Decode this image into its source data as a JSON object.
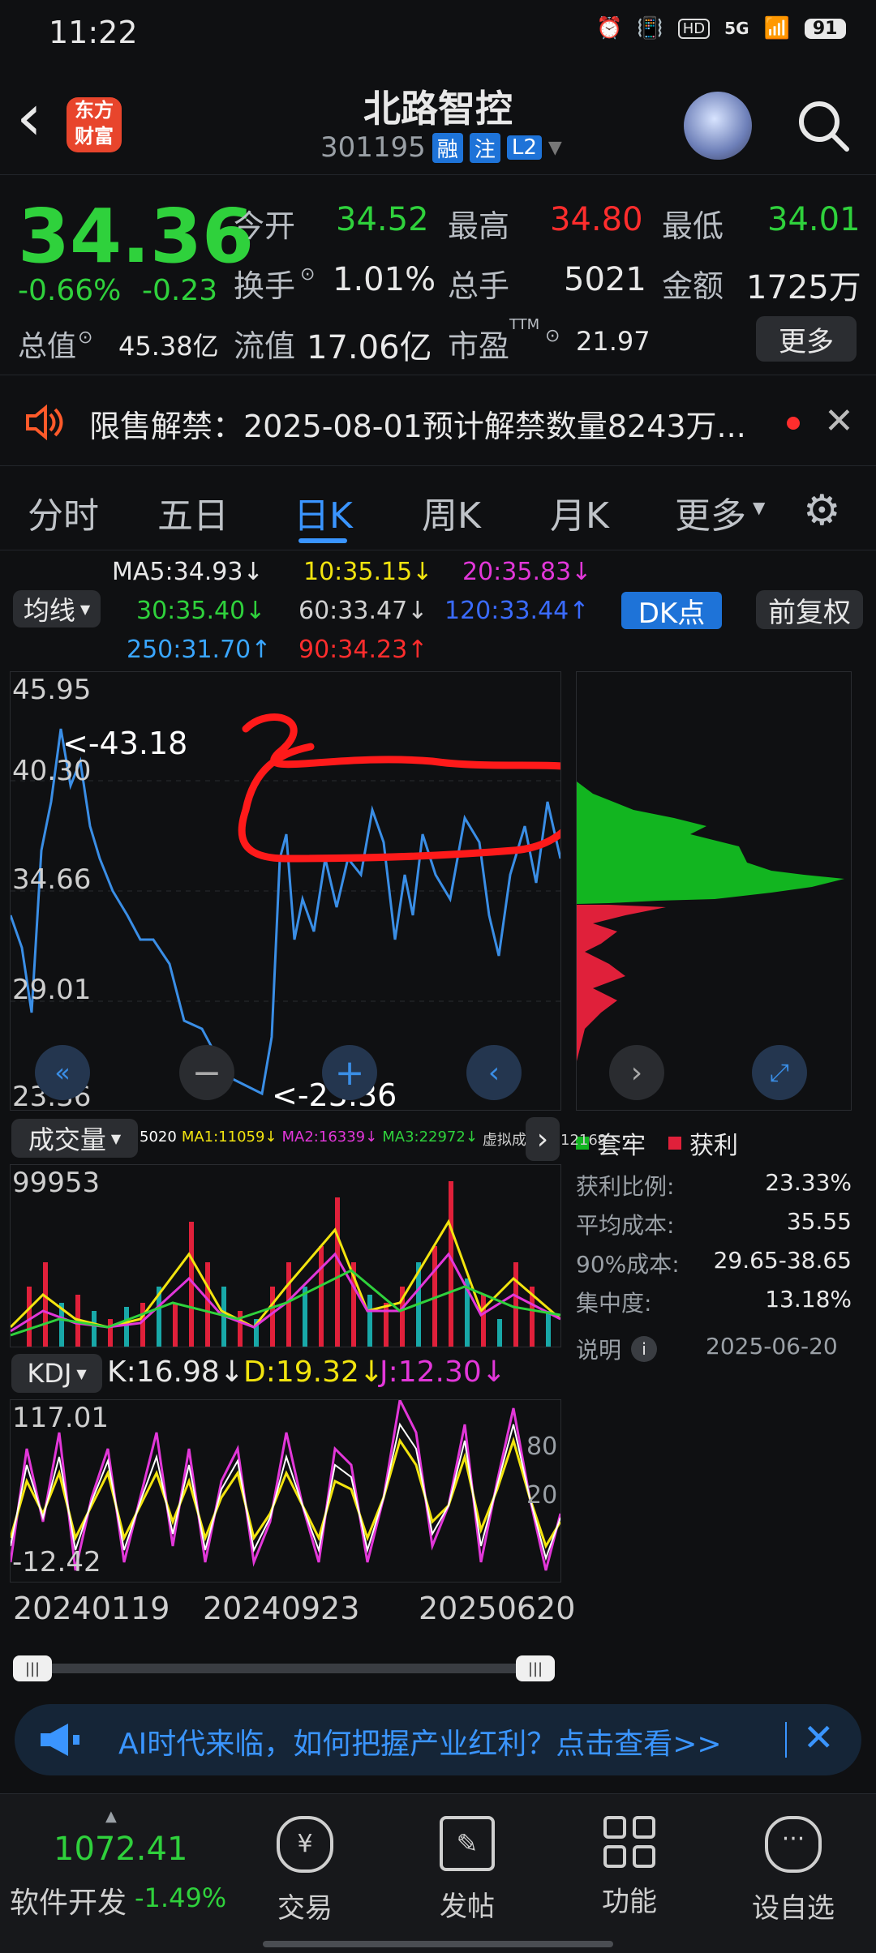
{
  "status": {
    "time": "11:22",
    "battery": "91",
    "network": "5G"
  },
  "header": {
    "back": "‹",
    "brand_line1": "东方",
    "brand_line2": "财富",
    "title": "北路智控",
    "code": "301195",
    "tags": [
      "融",
      "注",
      "L2"
    ]
  },
  "quote": {
    "price": "34.36",
    "pct": "-0.66%",
    "chg": "-0.23",
    "open_label": "今开",
    "open": "34.52",
    "high_label": "最高",
    "high": "34.80",
    "low_label": "最低",
    "low": "34.01",
    "turnover_label": "换手",
    "turnover": "1.01%",
    "volume_label": "总手",
    "volume": "5021",
    "amount_label": "金额",
    "amount": "1725万",
    "mktcap_label": "总值",
    "mktcap": "45.38亿",
    "float_label": "流值",
    "float": "17.06亿",
    "pe_label": "市盈",
    "pe_sup": "TTM",
    "pe": "21.97",
    "more": "更多"
  },
  "notice": {
    "text": "限售解禁：2025-08-01预计解禁数量8243万..."
  },
  "tabs": [
    "分时",
    "五日",
    "日K",
    "周K",
    "月K",
    "更多"
  ],
  "ma": {
    "label": "均线",
    "items": [
      {
        "t": "MA5:34.93↓",
        "c": "#ffffff"
      },
      {
        "t": "10:35.15↓",
        "c": "#f2e40f"
      },
      {
        "t": "20:35.83↓",
        "c": "#e237d9"
      },
      {
        "t": "30:35.40↓",
        "c": "#2fd13c"
      },
      {
        "t": "60:33.47↓",
        "c": "#d0d0d0"
      },
      {
        "t": "120:33.44↑",
        "c": "#3a6bff"
      },
      {
        "t": "250:31.70↑",
        "c": "#3aa6ff"
      },
      {
        "t": "90:34.23↑",
        "c": "#ff2d2d"
      }
    ],
    "dk": "DK点",
    "fuquan": "前复权"
  },
  "chart": {
    "y_labels": [
      "45.95",
      "40.30",
      "34.66",
      "29.01",
      "23.36"
    ],
    "max_note": "<-43.18",
    "min_note": "<-23.36"
  },
  "chip": {
    "legend_trap": "套牢",
    "legend_profit": "获利",
    "rows": [
      {
        "k": "获利比例:",
        "v": "23.33%"
      },
      {
        "k": "平均成本:",
        "v": "35.55"
      },
      {
        "k": "90%成本:",
        "v": "29.65-38.65"
      },
      {
        "k": "集中度:",
        "v": "13.18%"
      }
    ],
    "note": "说明",
    "date": "2025-06-20"
  },
  "volume": {
    "label": "成交量",
    "legend": [
      {
        "t": "5020",
        "c": "#ffffff"
      },
      {
        "t": "MA1:11059↓",
        "c": "#f2e40f"
      },
      {
        "t": "MA2:16339↓",
        "c": "#e237d9"
      },
      {
        "t": "MA3:22972↓",
        "c": "#2fd13c"
      },
      {
        "t": "虚拟成交量:12169",
        "c": "#cfcfcf"
      }
    ],
    "max": "99953"
  },
  "kdj": {
    "label": "KDJ",
    "k": "K:16.98↓",
    "d": "D:19.32↓",
    "j": "J:12.30↓",
    "top": "117.01",
    "bottom": "-12.42",
    "mid1": "80",
    "mid2": "20"
  },
  "xaxis": [
    "20240119",
    "20240923",
    "20250620"
  ],
  "ad": {
    "text": "AI时代来临，如何把握产业红利？点击查看>>"
  },
  "bottom": {
    "index_value": "1072.41",
    "index_name": "软件开发",
    "index_pct": "-1.49%",
    "nav": [
      "交易",
      "发帖",
      "功能",
      "设自选"
    ]
  }
}
